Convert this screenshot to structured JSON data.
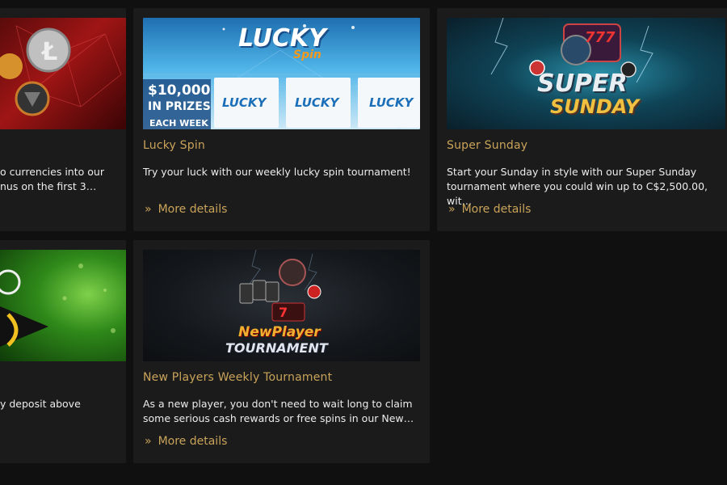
{
  "cards": [
    {
      "title": "",
      "desc_line1": "o currencies into our",
      "desc_line2": "nus on the first 3…",
      "more": ""
    },
    {
      "title": "Lucky Spin",
      "desc_line1": "Try your luck with our weekly lucky spin tournament!",
      "desc_line2": "",
      "more": "More details",
      "banner": {
        "logo_main": "LUCKY",
        "logo_sub": "Spin",
        "prize_line1": "$10,000",
        "prize_line2": "IN PRIZES",
        "prize_line3": "EACH WEEK",
        "reel_label": "LUCKY"
      }
    },
    {
      "title": "Super Sunday",
      "desc_line1": "Start your Sunday in style with our Super Sunday",
      "desc_line2": "tournament where you could win up to C$2,500.00, wit…",
      "more": "More details",
      "banner": {
        "slot_number": "777",
        "word1": "SUPER",
        "word2": "SUNDAY"
      }
    },
    {
      "title": "",
      "desc_line1": "y deposit above",
      "desc_line2": "",
      "more": ""
    },
    {
      "title": "New Players Weekly Tournament",
      "desc_line1": "As a new player, you don't need to wait long to claim",
      "desc_line2": "some serious cash rewards or free spins in our New…",
      "more": "More details",
      "banner": {
        "word1": "NewPlayer",
        "word2": "TOURNAMENT"
      }
    }
  ],
  "colors": {
    "page_bg": "#101010",
    "card_bg": "#1b1b1b",
    "accent_gold": "#c9a35a",
    "text": "#ececec"
  },
  "icons": {
    "more": "double-chevron-right-icon"
  }
}
